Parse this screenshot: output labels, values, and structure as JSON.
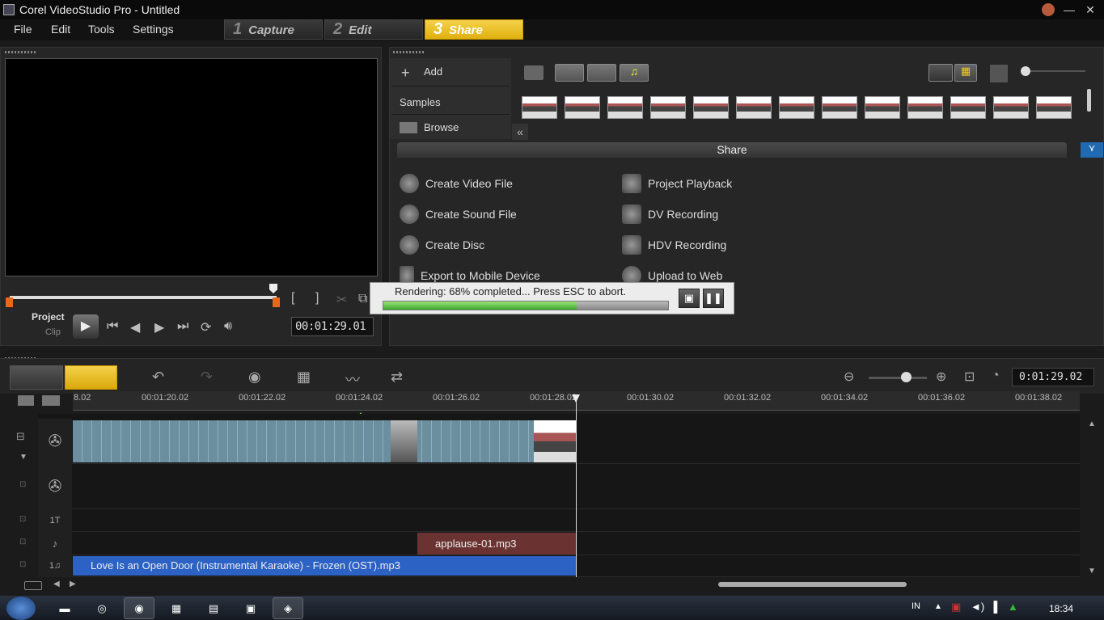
{
  "window": {
    "title": "Corel VideoStudio Pro - Untitled"
  },
  "menu": [
    "File",
    "Edit",
    "Tools",
    "Settings"
  ],
  "steps": [
    {
      "num": "1",
      "label": "Capture"
    },
    {
      "num": "2",
      "label": "Edit"
    },
    {
      "num": "3",
      "label": "Share"
    }
  ],
  "preview": {
    "project_label": "Project",
    "clip_label": "Clip",
    "timecode": "00:01:29.01",
    "mark_in": "[",
    "mark_out": "]"
  },
  "library": {
    "add_label": "Add",
    "samples_label": "Samples",
    "browse_label": "Browse",
    "collapse": "«"
  },
  "share": {
    "header": "Share",
    "options_left": [
      "Create Video File",
      "Create Sound File",
      "Create Disc",
      "Export to Mobile Device"
    ],
    "options_right": [
      "Project Playback",
      "DV Recording",
      "HDV Recording",
      "Upload to Web"
    ]
  },
  "render": {
    "text": "Rendering: 68% completed... Press ESC to abort.",
    "progress": 0.68
  },
  "timeline": {
    "timecode": "0:01:29.02",
    "ruler_ticks": [
      "8.02",
      "00:01:20.02",
      "00:01:22.02",
      "00:01:24.02",
      "00:01:26.02",
      "00:01:28.02",
      "00:01:30.02",
      "00:01:32.02",
      "00:01:34.02",
      "00:01:36.02",
      "00:01:38.02"
    ],
    "sound_clip": "applause-01.mp3",
    "music_clip": "Love Is an Open Door (Instrumental Karaoke) - Frozen (OST).mp3",
    "title_track_label": "1T",
    "music_track_label": "1♫"
  },
  "taskbar": {
    "lang": "IN",
    "clock": "18:34"
  },
  "colors": {
    "accent": "#f0c020",
    "progress": "#38a82e",
    "music": "#2c62c4",
    "sound": "#6a3331"
  }
}
